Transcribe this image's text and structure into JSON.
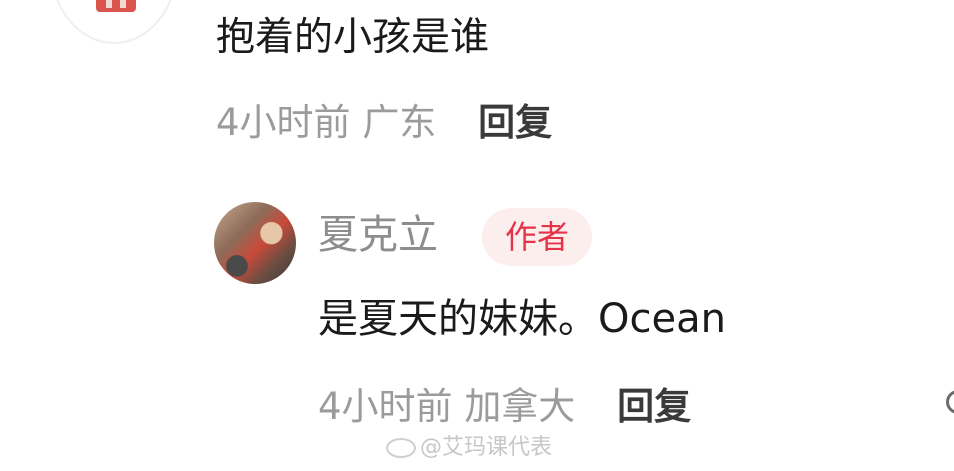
{
  "comment": {
    "text": "抱着的小孩是谁",
    "time": "4小时前",
    "location": "广东",
    "reply_label": "回复"
  },
  "reply": {
    "username": "夏克立",
    "badge": "作者",
    "text": "是夏天的妹妹。Ocean",
    "time": "4小时前",
    "location": "加拿大",
    "reply_label": "回复"
  },
  "watermark": {
    "text": "@艾玛课代表"
  },
  "icons": {
    "top_avatar": "user-avatar",
    "reply_avatar": "user-avatar-photo",
    "watermark": "weibo-icon",
    "edge": "search-icon"
  },
  "colors": {
    "badge_text": "#e5334a",
    "badge_bg": "#fdeeee",
    "meta_text": "#9b9b9b"
  }
}
